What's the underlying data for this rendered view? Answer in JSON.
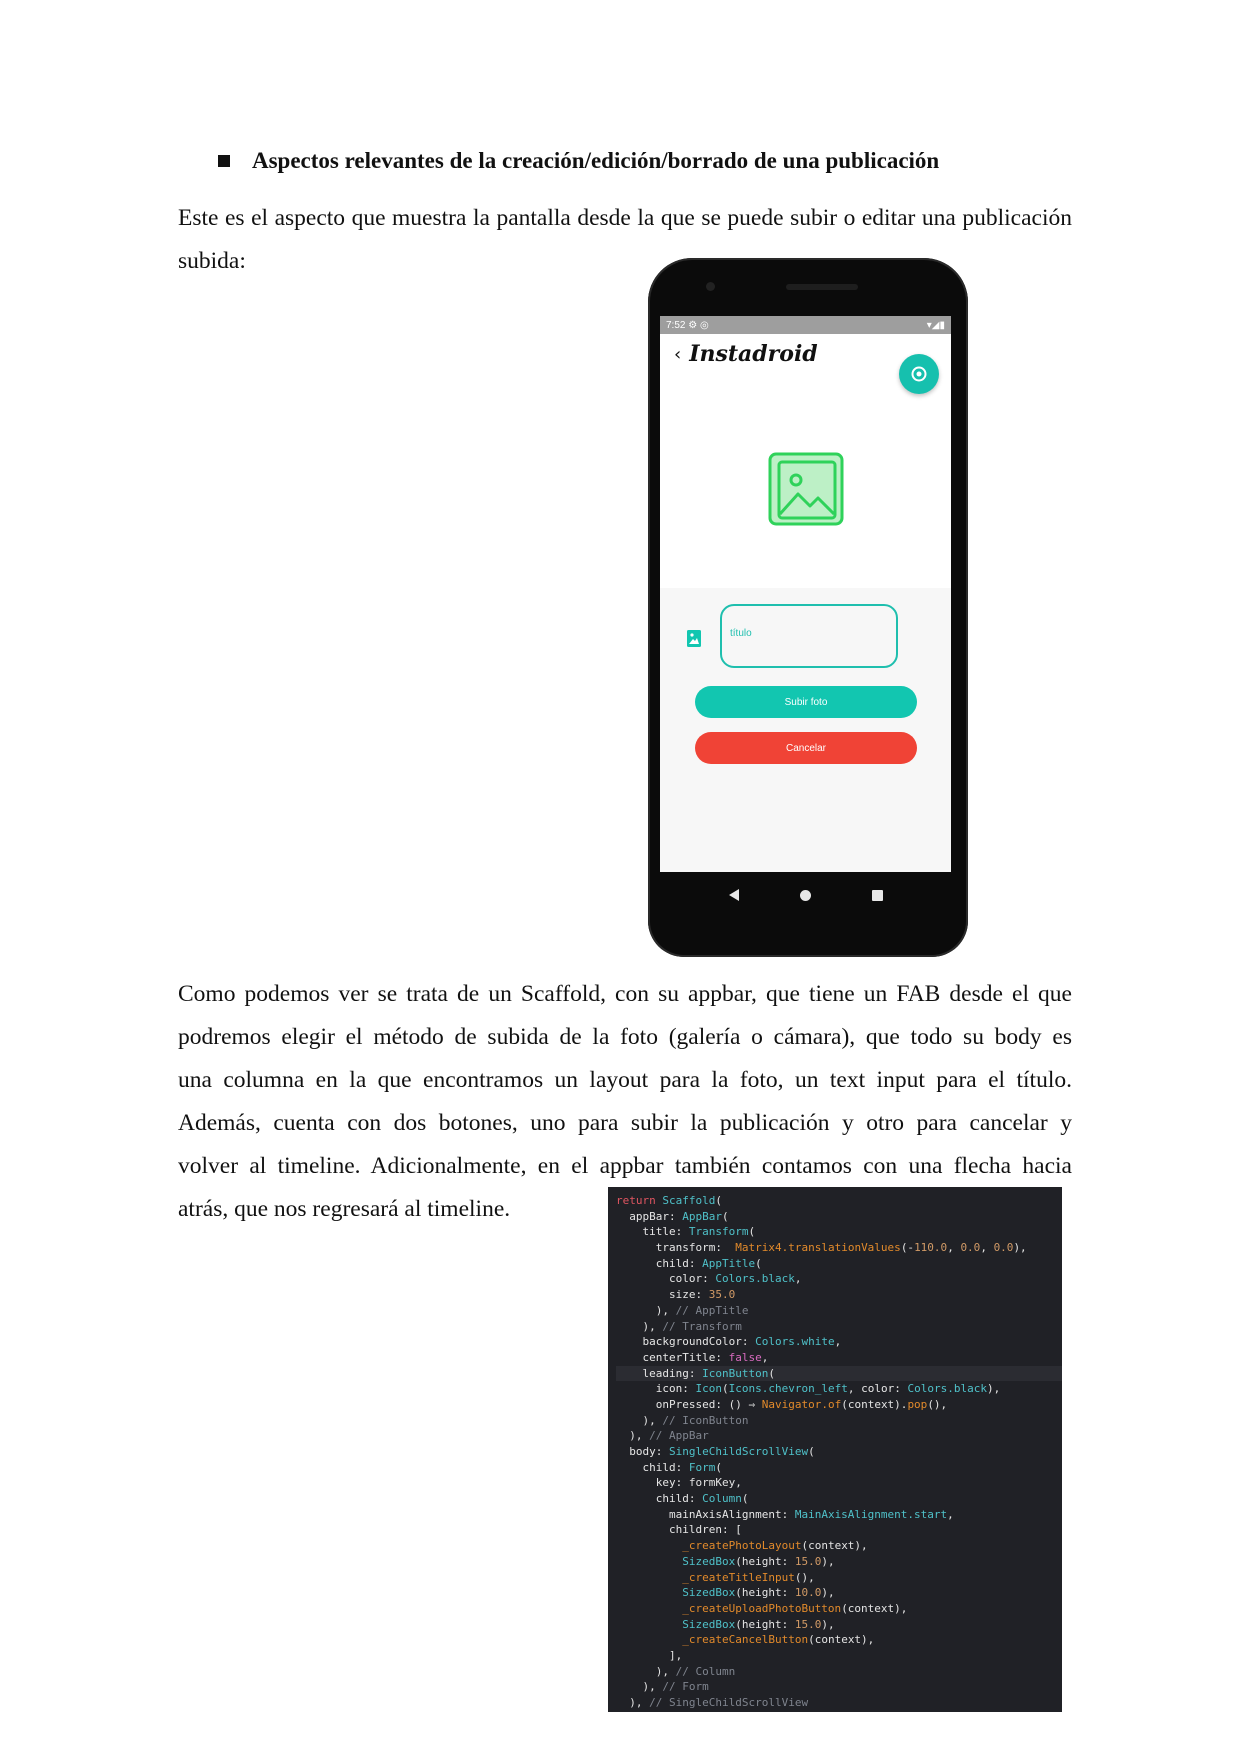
{
  "heading": "Aspectos relevantes de la creación/edición/borrado de una publicación",
  "paragraph1": "Este es el aspecto que muestra la pantalla desde la que se puede subir o editar una publicación subida:",
  "paragraph2_lines": [
    "Como podemos ver se trata de un Scaffold, con su appbar, que tiene un FAB desde el que",
    "podremos elegir el método de subida de la foto (galería o cámara), que todo su body es",
    "una columna en la que encontramos un layout para la foto, un text input para el título.",
    "Además, cuenta con dos botones, uno para subir la publicación y otro para cancelar y",
    "volver al timeline. Adicionalmente, en el appbar también contamos con una flecha hacia",
    "atrás, que nos regresará al timeline."
  ],
  "phone": {
    "status_time": "7:52",
    "status_icons_left": "⚙ ◎",
    "status_icons_right": "▾◢▮",
    "back_icon": "chevron-left-icon",
    "app_title": "Instadroid",
    "fab_icon": "camera-icon",
    "photo_placeholder_icon": "image-icon",
    "title_field_icon": "photo-album-icon",
    "title_placeholder": "título",
    "upload_button": "Subir foto",
    "cancel_button": "Cancelar",
    "colors": {
      "accent": "#12c6b0",
      "cancel": "#f04336",
      "placeholder_green": "#2fd25a"
    }
  },
  "code_lines": [
    "return Scaffold(",
    "  appBar: AppBar(",
    "    title: Transform(",
    "      transform:  Matrix4.translationValues(-110.0, 0.0, 0.0),",
    "      child: AppTitle(",
    "        color: Colors.black,",
    "        size: 35.0",
    "      ), // AppTitle",
    "    ), // Transform",
    "    backgroundColor: Colors.white,",
    "    centerTitle: false,",
    "    leading: IconButton(",
    "      icon: Icon(Icons.chevron_left, color: Colors.black),",
    "      onPressed: () ⇒ Navigator.of(context).pop(),",
    "    ), // IconButton",
    "  ), // AppBar",
    "  body: SingleChildScrollView(",
    "    child: Form(",
    "      key: formKey,",
    "      child: Column(",
    "        mainAxisAlignment: MainAxisAlignment.start,",
    "        children: [",
    "          _createPhotoLayout(context),",
    "          SizedBox(height: 15.0),",
    "          _createTitleInput(),",
    "          SizedBox(height: 10.0),",
    "          _createUploadPhotoButton(context),",
    "          SizedBox(height: 15.0),",
    "          _createCancelButton(context),",
    "        ],",
    "      ), // Column",
    "    ), // Form",
    "  ), // SingleChildScrollView"
  ]
}
